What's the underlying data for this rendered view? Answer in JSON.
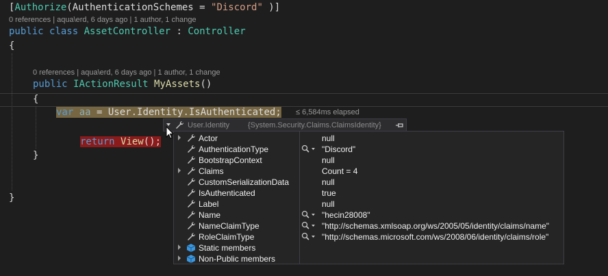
{
  "code": {
    "attr_open": "[",
    "attr_name": "Authorize",
    "attr_paren": "(AuthenticationSchemes = ",
    "attr_value": "\"Discord\"",
    "attr_close": " )]",
    "lens1": "0 references | aqua\\erd, 6 days ago | 1 author, 1 change",
    "class_kw1": "public",
    "class_kw2": "class",
    "class_name": "AssetController",
    "class_colon": " : ",
    "class_base": "Controller",
    "brace_open": "{",
    "lens2": "0 references | aqua\\erd, 6 days ago | 1 author, 1 change",
    "method_kw": "public",
    "method_type": "IActionResult",
    "method_name": "MyAssets",
    "method_parens": "()",
    "method_brace_open": "{",
    "var_kw": "var",
    "var_name": "aa",
    "var_rest": " = User.Identity.",
    "var_prop": "IsAuthenticated",
    "var_semi": ";",
    "elapsed": "≤ 6,584ms elapsed",
    "return_kw": "return",
    "return_call": "View",
    "return_rest": "();",
    "method_brace_close": "}",
    "class_brace_close": "}"
  },
  "datatip": {
    "expression": "User.Identity",
    "type": "{System.Security.Claims.ClaimsIdentity}",
    "rows": [
      {
        "name": "Actor",
        "value": "null",
        "expandable": true,
        "search": false
      },
      {
        "name": "AuthenticationType",
        "value": "\"Discord\"",
        "expandable": false,
        "search": true
      },
      {
        "name": "BootstrapContext",
        "value": "null",
        "expandable": false,
        "search": false
      },
      {
        "name": "Claims",
        "value": "Count = 4",
        "expandable": true,
        "search": false
      },
      {
        "name": "CustomSerializationData",
        "value": "null",
        "expandable": false,
        "search": false
      },
      {
        "name": "IsAuthenticated",
        "value": "true",
        "expandable": false,
        "search": false
      },
      {
        "name": "Label",
        "value": "null",
        "expandable": false,
        "search": false
      },
      {
        "name": "Name",
        "value": "\"hecin28008\"",
        "expandable": false,
        "search": true
      },
      {
        "name": "NameClaimType",
        "value": "\"http://schemas.xmlsoap.org/ws/2005/05/identity/claims/name\"",
        "expandable": false,
        "search": true
      },
      {
        "name": "RoleClaimType",
        "value": "\"http://schemas.microsoft.com/ws/2008/06/identity/claims/role\"",
        "expandable": false,
        "search": true
      },
      {
        "name": "Static members",
        "value": "",
        "expandable": true,
        "search": false
      },
      {
        "name": "Non-Public members",
        "value": "",
        "expandable": true,
        "search": false
      }
    ]
  },
  "colors": {
    "background": "#1e1e1e",
    "keyword": "#569cd6",
    "type": "#4ec9b0",
    "method": "#dcdcaa",
    "string": "#d69d85",
    "current_statement": "#766642",
    "breakpoint": "#8b1a1a"
  }
}
